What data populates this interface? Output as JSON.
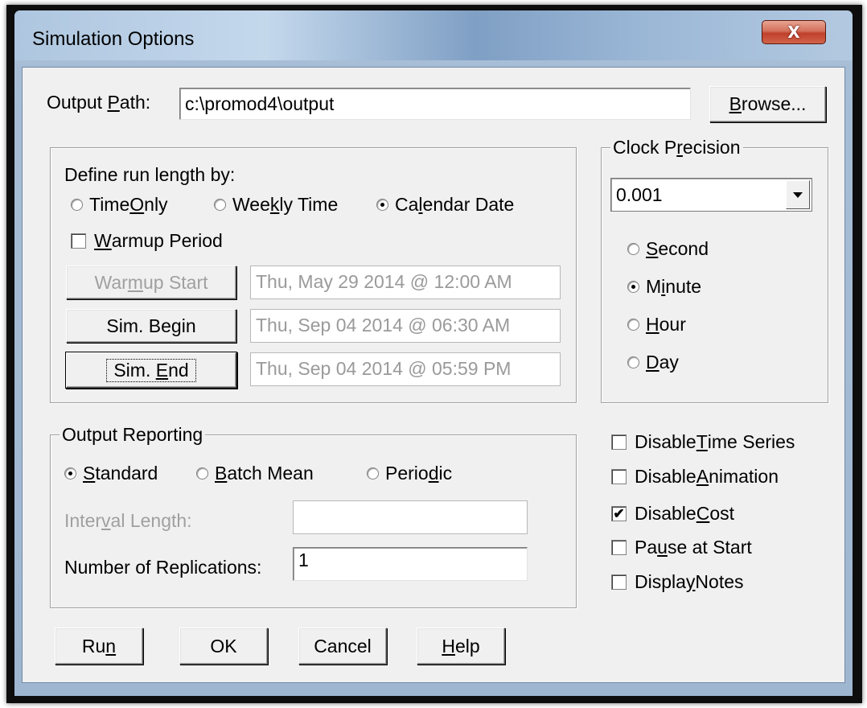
{
  "window": {
    "title": "Simulation Options",
    "close_glyph": "X"
  },
  "output_path": {
    "label_pre": "Output ",
    "label_mnemonic": "P",
    "label_post": "ath:",
    "value": "c:\\promod4\\output",
    "browse": {
      "pre": "",
      "mn": "B",
      "post": "rowse..."
    }
  },
  "run_length": {
    "heading": "Define run length by:",
    "options": [
      {
        "pre": "Time ",
        "mn": "O",
        "post": "nly",
        "selected": false
      },
      {
        "pre": "Wee",
        "mn": "k",
        "post": "ly Time",
        "selected": false
      },
      {
        "pre": "Ca",
        "mn": "l",
        "post": "endar Date",
        "selected": true
      }
    ],
    "warmup_period": {
      "pre": "",
      "mn": "W",
      "post": "armup Period",
      "checked": false
    },
    "warmup_start": {
      "pre": "War",
      "mn": "m",
      "post": "up Start",
      "value": "Thu, May 29 2014 @ 12:00 AM"
    },
    "sim_begin": {
      "pre": "Sim. Be",
      "mn": "g",
      "post": "in",
      "value": "Thu, Sep 04 2014 @ 06:30 AM"
    },
    "sim_end": {
      "pre": "Sim. ",
      "mn": "E",
      "post": "nd",
      "value": "Thu, Sep 04 2014 @ 05:59 PM"
    }
  },
  "clock_precision": {
    "title_pre": "Clock P",
    "title_mn": "r",
    "title_post": "ecision",
    "value": "0.001",
    "units": [
      {
        "pre": "",
        "mn": "S",
        "post": "econd",
        "selected": false
      },
      {
        "pre": "M",
        "mn": "i",
        "post": "nute",
        "selected": true
      },
      {
        "pre": "",
        "mn": "H",
        "post": "our",
        "selected": false
      },
      {
        "pre": "",
        "mn": "D",
        "post": "ay",
        "selected": false
      }
    ]
  },
  "output_reporting": {
    "title": "Output Reporting",
    "options": [
      {
        "pre": "",
        "mn": "S",
        "post": "tandard",
        "selected": true
      },
      {
        "pre": "",
        "mn": "B",
        "post": "atch Mean",
        "selected": false
      },
      {
        "pre": "Perio",
        "mn": "d",
        "post": "ic",
        "selected": false
      }
    ],
    "interval_label": {
      "pre": "Inter",
      "mn": "v",
      "post": "al Length:"
    },
    "interval_value": "",
    "replications_label": "Number of Replications:",
    "replications_value": "1"
  },
  "checkboxes": [
    {
      "pre": "Disable ",
      "mn": "T",
      "post": "ime Series",
      "checked": false
    },
    {
      "pre": "Disable ",
      "mn": "A",
      "post": "nimation",
      "checked": false
    },
    {
      "pre": "Disable ",
      "mn": "C",
      "post": "ost",
      "checked": true
    },
    {
      "pre": "Pa",
      "mn": "u",
      "post": "se at Start",
      "checked": false
    },
    {
      "pre": "Displa",
      "mn": "y",
      "post": " Notes",
      "checked": false
    }
  ],
  "buttons": {
    "run": {
      "pre": "Ru",
      "mn": "n",
      "post": ""
    },
    "ok": "OK",
    "cancel": "Cancel",
    "help": {
      "pre": "",
      "mn": "H",
      "post": "elp"
    }
  },
  "check_glyph": "✔"
}
